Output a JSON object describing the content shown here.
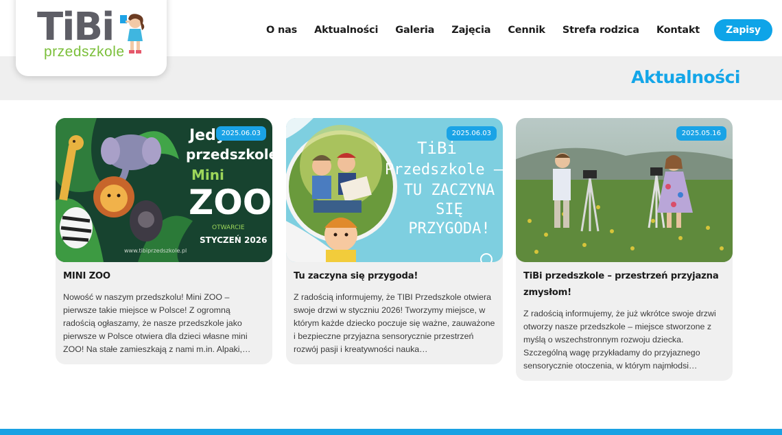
{
  "logo": {
    "name": "TiBi",
    "sub": "przedszkole"
  },
  "nav": {
    "items": [
      "O nas",
      "Aktualności",
      "Galeria",
      "Zajęcia",
      "Cennik",
      "Strefa rodzica",
      "Kontakt"
    ],
    "cta": "Zapisy"
  },
  "page": {
    "title": "Aktualności"
  },
  "cards": [
    {
      "date": "2025.06.03",
      "title": "MINI ZOO",
      "excerpt": "Nowość w naszym przedszkolu! Mini ZOO – pierwsze takie miejsce w Polsce! Z ogromną radością ogłaszamy, że nasze przedszkole jako pierwsze w Polsce otwiera dla dzieci własne mini ZOO! Na stałe zamieszkają z nami m.in. Alpaki,…",
      "image": {
        "line1": "Jedy",
        "line2": "przedszkole",
        "line3": "Mini",
        "line4": "ZOO",
        "line5": "OTWARCIE",
        "line6": "STYCZEŃ 2026",
        "url": "www.tibiprzedszkole.pl"
      }
    },
    {
      "date": "2025.06.03",
      "title": "Tu zaczyna się przygoda!",
      "excerpt": "Z radością informujemy, że TIBI Przedszkole otwiera swoje drzwi w styczniu 2026! Tworzymy miejsce, w którym każde dziecko poczuje się ważne, zauważone i bezpieczne przyjazna sensorycznie przestrzeń rozwój pasji i kreatywności nauka…",
      "image": {
        "line1": "TiBi",
        "line2": "Przedszkole –",
        "line3": "TU ZACZYNA",
        "line4": "SIĘ",
        "line5": "PRZYGODA!"
      }
    },
    {
      "date": "2025.05.16",
      "title": "TiBi przedszkole – przestrzeń przyjazna zmysłom!",
      "excerpt": "Z radością informujemy, że już wkrótce swoje drzwi otworzy nasze  przedszkole – miejsce stworzone z myślą o wszechstronnym rozwoju dziecka. Szczególną wagę przykładamy do przyjaznego sensorycznie otoczenia, w którym najmłodsi…"
    }
  ],
  "colors": {
    "accent": "#14a6e8",
    "logo_gray": "#5e5e66",
    "logo_green": "#7bbf3a",
    "card_bg": "#f0f0f0"
  }
}
